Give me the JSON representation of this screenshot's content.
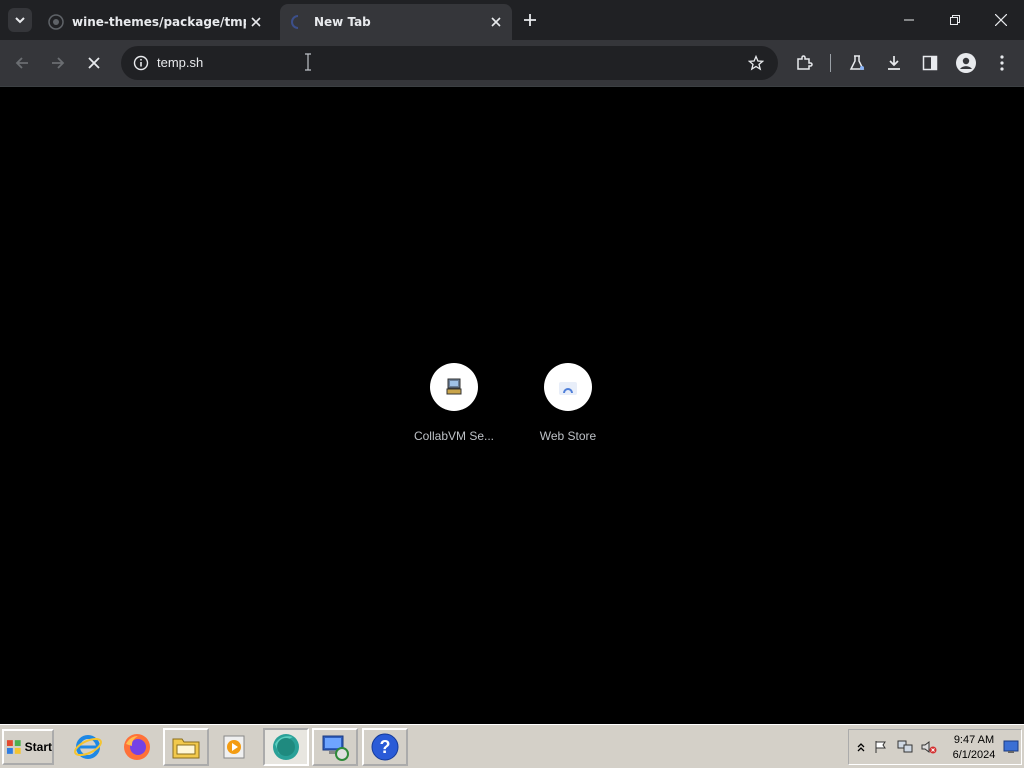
{
  "browser": {
    "tabs": [
      {
        "title": "wine-themes/package/tmp/wi",
        "icon": "github-icon",
        "active": false
      },
      {
        "title": "New Tab",
        "icon": "loading-icon",
        "active": true
      }
    ],
    "address": "temp.sh"
  },
  "shortcuts": [
    {
      "label": "CollabVM Se...",
      "icon": "computer-icon"
    },
    {
      "label": "Web Store",
      "icon": "web-store-icon"
    }
  ],
  "taskbar": {
    "start_label": "Start",
    "quick_launch": [
      "internet-explorer-icon",
      "firefox-icon",
      "file-manager-icon",
      "media-player-icon",
      "chrome-icon",
      "remote-desktop-icon",
      "help-icon"
    ],
    "clock_time": "9:47 AM",
    "clock_date": "6/1/2024"
  },
  "colors": {
    "tabstrip": "#202124",
    "toolbar": "#35363a",
    "page_background": "#000000",
    "taskbar": "#d4d0c8"
  }
}
